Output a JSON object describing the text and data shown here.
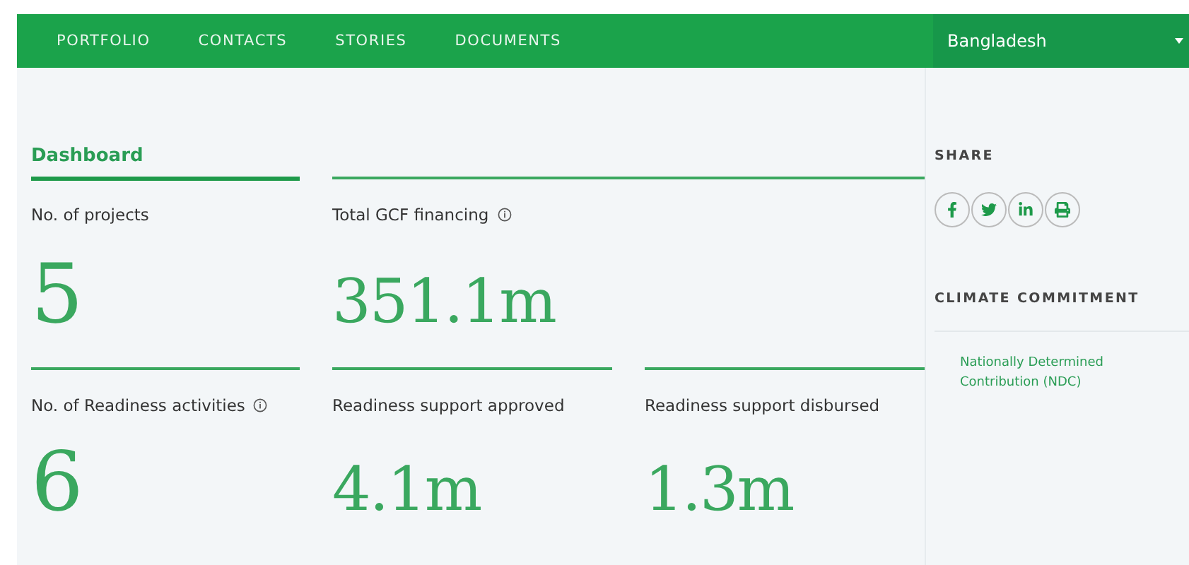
{
  "nav": {
    "items": [
      {
        "label": "PORTFOLIO"
      },
      {
        "label": "CONTACTS"
      },
      {
        "label": "STORIES"
      },
      {
        "label": "DOCUMENTS"
      }
    ],
    "country_select": {
      "value": "Bangladesh"
    }
  },
  "dashboard": {
    "tab": {
      "label": "Dashboard",
      "selected": true
    },
    "rows": [
      [
        {
          "label": "No. of projects",
          "info": false,
          "value": "5",
          "kind": "count"
        },
        {
          "label": "Total GCF financing",
          "info": true,
          "value": "351.1m",
          "kind": "amount"
        }
      ],
      [
        {
          "label": "No. of Readiness activities",
          "info": true,
          "value": "6",
          "kind": "count"
        },
        {
          "label": "Readiness support approved",
          "info": false,
          "value": "4.1m",
          "kind": "amount"
        },
        {
          "label": "Readiness support disbursed",
          "info": false,
          "value": "1.3m",
          "kind": "amount"
        }
      ]
    ]
  },
  "sidebar": {
    "share_title": "SHARE",
    "commitment_title": "CLIMATE COMMITMENT",
    "commitment_link": "Nationally Determined Contribution (NDC)"
  }
}
